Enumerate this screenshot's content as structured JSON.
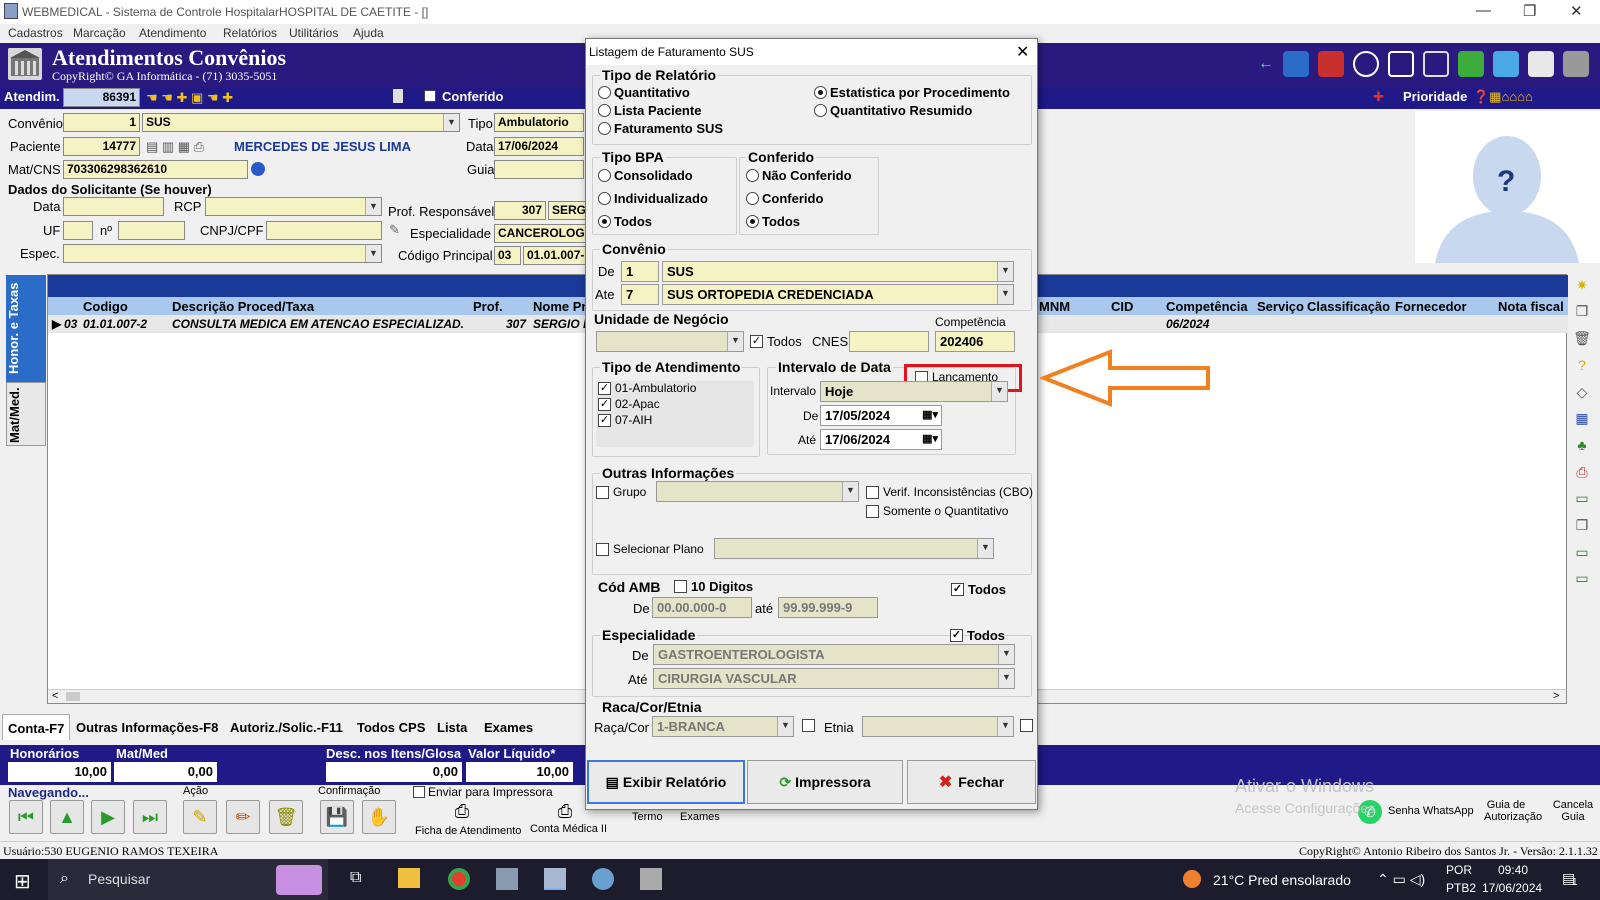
{
  "window": {
    "title": "WEBMEDICAL - Sistema de Controle HospitalarHOSPITAL DE CAETITE - []",
    "min": "—",
    "max": "❐",
    "close": "✕"
  },
  "menu": [
    "Cadastros",
    "Marcação",
    "Atendimento",
    "Relatórios",
    "Utilitários",
    "Ajuda"
  ],
  "banner": {
    "title": "Atendimentos Convênios",
    "copyright": "CopyRight© GA Informática - (71) 3035-5051",
    "prioridade": "Prioridade"
  },
  "atendimento": {
    "label": "Atendim.",
    "value": "86391",
    "conferido": "Conferido"
  },
  "form": {
    "convenio_label": "Convênio",
    "convenio_code": "1",
    "convenio_name": "SUS",
    "tipo_label": "Tipo",
    "tipo_value": "Ambulatorio",
    "paciente_label": "Paciente",
    "paciente_code": "14777",
    "paciente_name": "MERCEDES DE JESUS LIMA",
    "data_label": "Data",
    "data_value": "17/06/2024",
    "matcns_label": "Mat/CNS",
    "matcns_value": "703306298362610",
    "guia_label": "Guia",
    "solicitante_title": "Dados do Solicitante (Se houver)",
    "sol_data": "Data",
    "rcp": "RCP",
    "uf": "UF",
    "n": "nº",
    "cnpj": "CNPJ/CPF",
    "espec": "Espec.",
    "prof_label": "Prof. Responsável",
    "prof_code": "307",
    "prof_name": "SERG",
    "especialidade_label": "Especialidade",
    "especialidade_value": "CANCEROLOG",
    "codigo_label": "Código Principal",
    "codigo_num": "03",
    "codigo_value": "01.01.007-"
  },
  "side_tabs": [
    "Honor. e Taxas",
    "Mat/Med."
  ],
  "grid": {
    "headers": [
      "Codigo",
      "Descrição Proced/Taxa",
      "Prof.",
      "Nome Pr",
      "MNM",
      "CID",
      "Competência",
      "Serviço",
      "Classificação",
      "Fornecedor",
      "Nota fiscal"
    ],
    "row": {
      "num": "03",
      "codigo": "01.01.007-2",
      "descricao": "CONSULTA MEDICA EM ATENCAO ESPECIALIZAD.",
      "prof": "307",
      "nome": "SERGIO R",
      "competencia": "06/2024"
    }
  },
  "bottom_tabs": [
    "Conta-F7",
    "Outras Informações-F8",
    "Autoriz./Solic.-F11",
    "Todos CPS",
    "Lista",
    "Exames"
  ],
  "totals": {
    "honorarios_label": "Honorários",
    "honorarios": "10,00",
    "matmed_label": "Mat/Med",
    "matmed": "0,00",
    "desc_label": "Desc. nos Itens/Glosa",
    "desc": "0,00",
    "liquido_label": "Valor Líquido*",
    "liquido": "10,00"
  },
  "nav": {
    "navegando": "Navegando...",
    "acao": "Ação",
    "confirmacao": "Confirmação",
    "enviar": "Enviar para Impressora",
    "ficha": "Ficha de Atendimento",
    "conta_medica": "Conta Médica II",
    "termo": "Termo",
    "exames": "Exames",
    "whatsapp": "Senha WhatsApp",
    "guia_aut": "Guia de Autorização",
    "cancela": "Cancela Guia"
  },
  "watermark": {
    "line1": "Ativar o Windows",
    "line2": "Acesse Configurações"
  },
  "status": {
    "user": "Usuário:530 EUGENIO RAMOS TEXEIRA",
    "copyright": "CopyRight© Antonio Ribeiro dos Santos Jr. - Versão: 2.1.1.32"
  },
  "taskbar": {
    "search": "Pesquisar",
    "weather": "21°C  Pred ensolarado",
    "lang1": "POR",
    "lang2": "PTB2",
    "time": "09:40",
    "date": "17/06/2024",
    "notif": "1"
  },
  "dialog": {
    "title": "Listagem de Faturamento SUS",
    "tipo_relatorio": {
      "title": "Tipo de Relatório",
      "options": [
        "Quantitativo",
        "Lista Paciente",
        "Faturamento SUS",
        "Estatistica por Procedimento",
        "Quantitativo Resumido"
      ],
      "selected": "Estatistica por Procedimento"
    },
    "tipo_bpa": {
      "title": "Tipo BPA",
      "options": [
        "Consolidado",
        "Individualizado",
        "Todos"
      ],
      "selected": "Todos"
    },
    "conferido": {
      "title": "Conferido",
      "options": [
        "Não Conferido",
        "Conferido",
        "Todos"
      ],
      "selected": "Todos"
    },
    "convenio": {
      "title": "Convênio",
      "de_label": "De",
      "de_code": "1",
      "de_name": "SUS",
      "ate_label": "Ate",
      "ate_code": "7",
      "ate_name": "SUS ORTOPEDIA CREDENCIADA"
    },
    "unidade": {
      "title": "Unidade de Negócio",
      "todos": "Todos",
      "cnes": "CNES",
      "competencia_label": "Competência",
      "competencia": "202406"
    },
    "tipo_atendimento": {
      "title": "Tipo de Atendimento",
      "items": [
        "01-Ambulatorio",
        "02-Apac",
        "07-AIH"
      ]
    },
    "intervalo": {
      "title": "Intervalo de Data",
      "lancamento": "Lançamento",
      "intervalo_label": "Intervalo",
      "intervalo_value": "Hoje",
      "de_label": "De",
      "de_value": "17/05/2024",
      "ate_label": "Até",
      "ate_value": "17/06/2024"
    },
    "outras": {
      "title": "Outras Informações",
      "grupo": "Grupo",
      "verif": "Verif. Inconsistências (CBO)",
      "somente": "Somente o Quantitativo",
      "selecionar_plano": "Selecionar Plano"
    },
    "cod_amb": {
      "title": "Cód AMB",
      "digitos": "10 Digitos",
      "todos": "Todos",
      "de_label": "De",
      "de_value": "00.00.000-0",
      "ate_label": "até",
      "ate_value": "99.99.999-9"
    },
    "especialidade": {
      "title": "Especialidade",
      "todos": "Todos",
      "de_label": "De",
      "de_value": "GASTROENTEROLOGISTA",
      "ate_label": "Até",
      "ate_value": "CIRURGIA VASCULAR"
    },
    "raca": {
      "title": "Raca/Cor/Etnia",
      "raca_label": "Raça/Cor",
      "raca_value": "1-BRANCA",
      "etnia_label": "Etnia"
    },
    "buttons": {
      "exibir": "Exibir Relatório",
      "impressora": "Impressora",
      "fechar": "Fechar"
    }
  },
  "colors": {
    "banner": "#2a1a80",
    "grid_header": "#a9c8ee",
    "highlight_box": "#e0141c",
    "arrow": "#f08020"
  }
}
